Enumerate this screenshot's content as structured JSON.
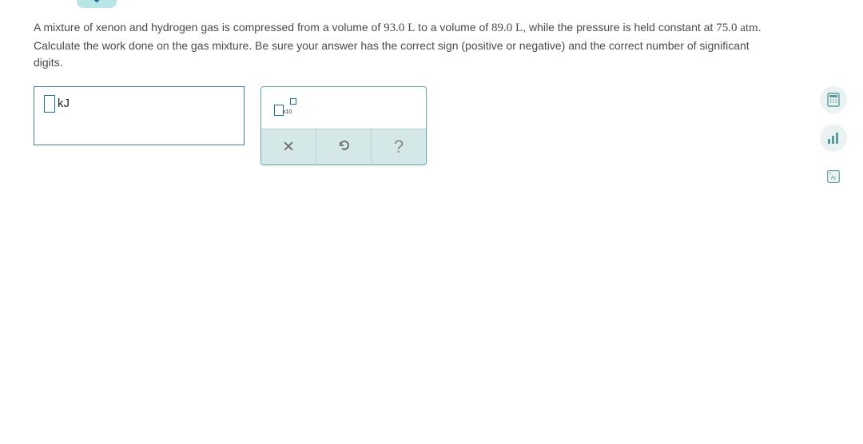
{
  "question": {
    "pre1": "A mixture of xenon and hydrogen gas is compressed from a volume of ",
    "vol1": "93.0 L",
    "mid1": " to a volume of ",
    "vol2": "89.0 L",
    "mid2": ", while the pressure is held constant at ",
    "pressure": "75.0 atm",
    "post": ". Calculate the work done on the gas mixture. Be sure your answer has the correct sign (positive or negative) and the correct number of significant digits."
  },
  "answer": {
    "unit": "kJ"
  },
  "toolbox": {
    "sci_label": "x10",
    "clear": "✕",
    "reset": "↺",
    "help": "?"
  },
  "side": {
    "calculator": "calculator-icon",
    "chart": "bar-chart-icon",
    "periodic": "periodic-table-icon",
    "periodic_label": "Ar"
  }
}
